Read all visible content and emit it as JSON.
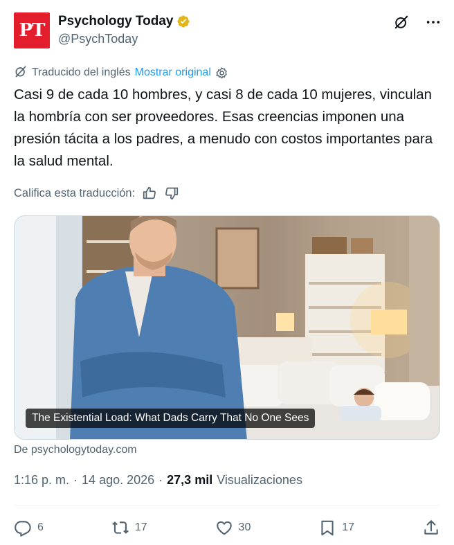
{
  "author": {
    "logo_text": "PT",
    "name": "Psychology Today",
    "handle": "@PsychToday",
    "verified_color": "#e2b719"
  },
  "translation": {
    "note": "Traducido del inglés",
    "show_original": "Mostrar original"
  },
  "tweet": {
    "text": "Casi 9 de cada 10 hombres, y casi 8 de cada 10 mujeres, vinculan la hombría con ser proveedores. Esas creencias imponen una presión tácita a los padres, a menudo con costos importantes para la salud mental."
  },
  "rate_translation": {
    "label": "Califica esta traducción:"
  },
  "card": {
    "caption": "The Existential Load: What Dads Carry That No One Sees",
    "source": "De psychologytoday.com"
  },
  "meta": {
    "time": "1:16 p. m.",
    "sep1": "·",
    "date": "14 ago. 2026",
    "sep2": "·",
    "views_count": "27,3 mil",
    "views_label": "Visualizaciones"
  },
  "stats": {
    "replies": "6",
    "reposts": "17",
    "likes": "30",
    "bookmarks": "17"
  },
  "colors": {
    "accent": "#1d9bf0",
    "brand_red": "#e31d2b",
    "muted": "#536471"
  },
  "icons": [
    "verified-badge-icon",
    "grok-icon",
    "more-icon",
    "translate-icon",
    "settings-icon",
    "thumbs-up-icon",
    "thumbs-down-icon",
    "reply-icon",
    "repost-icon",
    "like-icon",
    "bookmark-icon",
    "share-icon"
  ]
}
